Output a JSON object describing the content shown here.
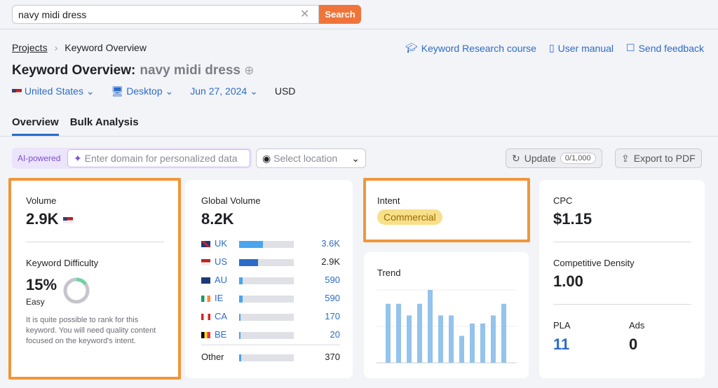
{
  "search": {
    "value": "navy midi dress",
    "button": "Search"
  },
  "breadcrumb": {
    "root": "Projects",
    "current": "Keyword Overview"
  },
  "header_links": [
    "Keyword Research course",
    "User manual",
    "Send feedback"
  ],
  "title": {
    "label": "Keyword Overview:",
    "keyword": "navy midi dress"
  },
  "filters": {
    "country": "United States",
    "device": "Desktop",
    "date": "Jun 27, 2024",
    "currency": "USD"
  },
  "tabs": [
    "Overview",
    "Bulk Analysis"
  ],
  "toolbar": {
    "ai_label": "AI-powered",
    "domain_placeholder": "Enter domain for personalized data",
    "location_placeholder": "Select location",
    "update": "Update",
    "update_count": "0/1,000",
    "export": "Export to PDF"
  },
  "volume": {
    "label": "Volume",
    "value": "2.9K"
  },
  "kd": {
    "label": "Keyword Difficulty",
    "value": "15%",
    "percent": 15,
    "level": "Easy",
    "description": "It is quite possible to rank for this keyword. You will need quality content focused on the keyword's intent."
  },
  "global_volume": {
    "label": "Global Volume",
    "value": "8.2K",
    "rows": [
      {
        "code": "UK",
        "value": "3.6K",
        "share": 0.44,
        "color": "#4aa4ee"
      },
      {
        "code": "US",
        "value": "2.9K",
        "share": 0.35,
        "color": "#2d6bc8"
      },
      {
        "code": "AU",
        "value": "590",
        "share": 0.07,
        "color": "#4aa4ee"
      },
      {
        "code": "IE",
        "value": "590",
        "share": 0.07,
        "color": "#4aa4ee"
      },
      {
        "code": "CA",
        "value": "170",
        "share": 0.03,
        "color": "#4aa4ee"
      },
      {
        "code": "BE",
        "value": "20",
        "share": 0.03,
        "color": "#4aa4ee"
      }
    ],
    "other": {
      "label": "Other",
      "value": "370",
      "share": 0.04
    }
  },
  "intent": {
    "label": "Intent",
    "value": "Commercial"
  },
  "trend": {
    "label": "Trend",
    "values": [
      0.81,
      0.81,
      0.65,
      0.81,
      1.0,
      0.65,
      0.65,
      0.37,
      0.54,
      0.54,
      0.65,
      0.81
    ]
  },
  "cpc": {
    "label": "CPC",
    "value": "$1.15"
  },
  "density": {
    "label": "Competitive Density",
    "value": "1.00"
  },
  "pla": {
    "label": "PLA",
    "value": "11"
  },
  "ads": {
    "label": "Ads",
    "value": "0"
  }
}
